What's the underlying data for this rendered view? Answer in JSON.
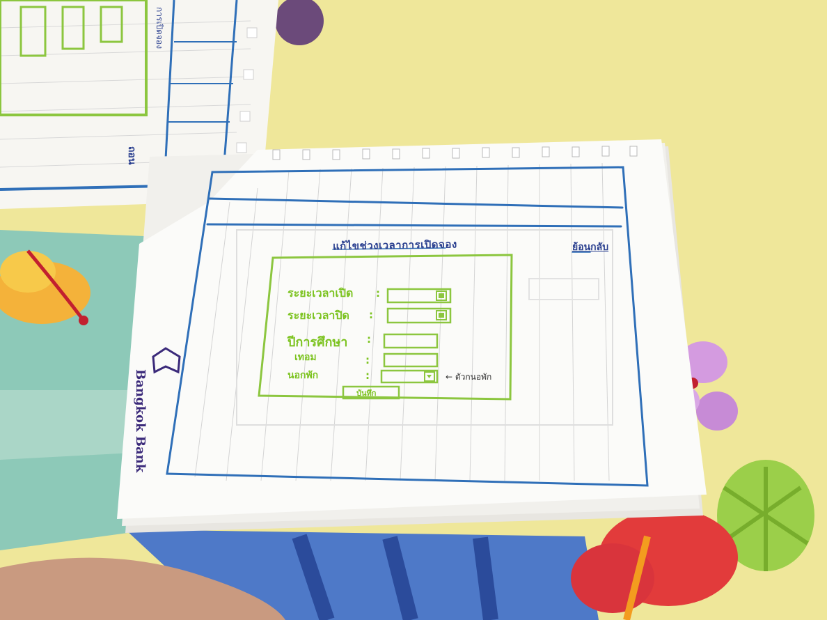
{
  "sketch": {
    "title": "แก้ไขช่วงเวลาการเปิดจอง",
    "back_link": "ย้อนกลับ",
    "fields": [
      {
        "label": "ระยะเวลาเปิด",
        "control": "date-picker"
      },
      {
        "label": "ระยะเวลาปิด",
        "control": "date-picker"
      },
      {
        "label": "ปีการศึกษา",
        "control": "text-box"
      },
      {
        "label": "เทอม",
        "control": "text-box"
      },
      {
        "label": "นอกพัก",
        "control": "dropdown"
      }
    ],
    "colon": ":",
    "save_button": "บันทึก",
    "annotation": "← ตัวกนอพัก"
  },
  "notebook": {
    "logo": "Bangkok Bank"
  },
  "top_page": {
    "side_text": "การเปิดจอง",
    "bottom_text": "ถอน"
  },
  "colors": {
    "ink_blue": "#2f6fb8",
    "ink_green": "#8cc63f",
    "logo_purple": "#3b2a7a",
    "bedsheet_yellow": "#efe79a",
    "bedsheet_teal": "#8dc9b8"
  }
}
